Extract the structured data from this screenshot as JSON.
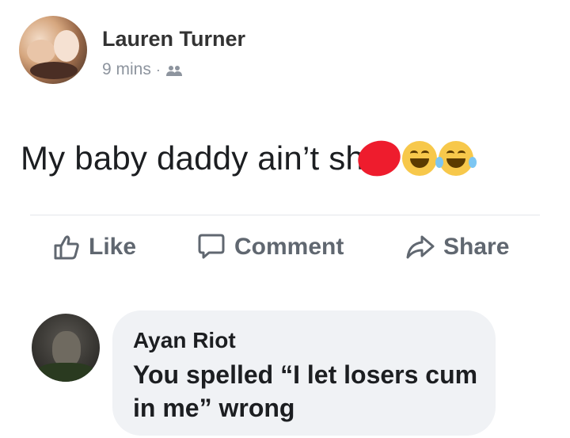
{
  "post": {
    "author": "Lauren Turner",
    "time": "9 mins",
    "separator": "·",
    "privacy_icon": "friends-icon",
    "status_text": "My baby daddy ain’t sh",
    "emojis": [
      "laughing-emoji",
      "crying-laughing-emoji"
    ]
  },
  "actions": {
    "like_label": "Like",
    "comment_label": "Comment",
    "share_label": "Share"
  },
  "comment": {
    "author": "Ayan Riot",
    "text": "You spelled “I let losers cum in me” wrong"
  },
  "colors": {
    "meta_gray": "#8d949e",
    "action_gray": "#606770",
    "bubble_bg": "#f0f2f5",
    "redaction": "#ee1c2d",
    "emoji_yellow": "#f7c84b"
  }
}
